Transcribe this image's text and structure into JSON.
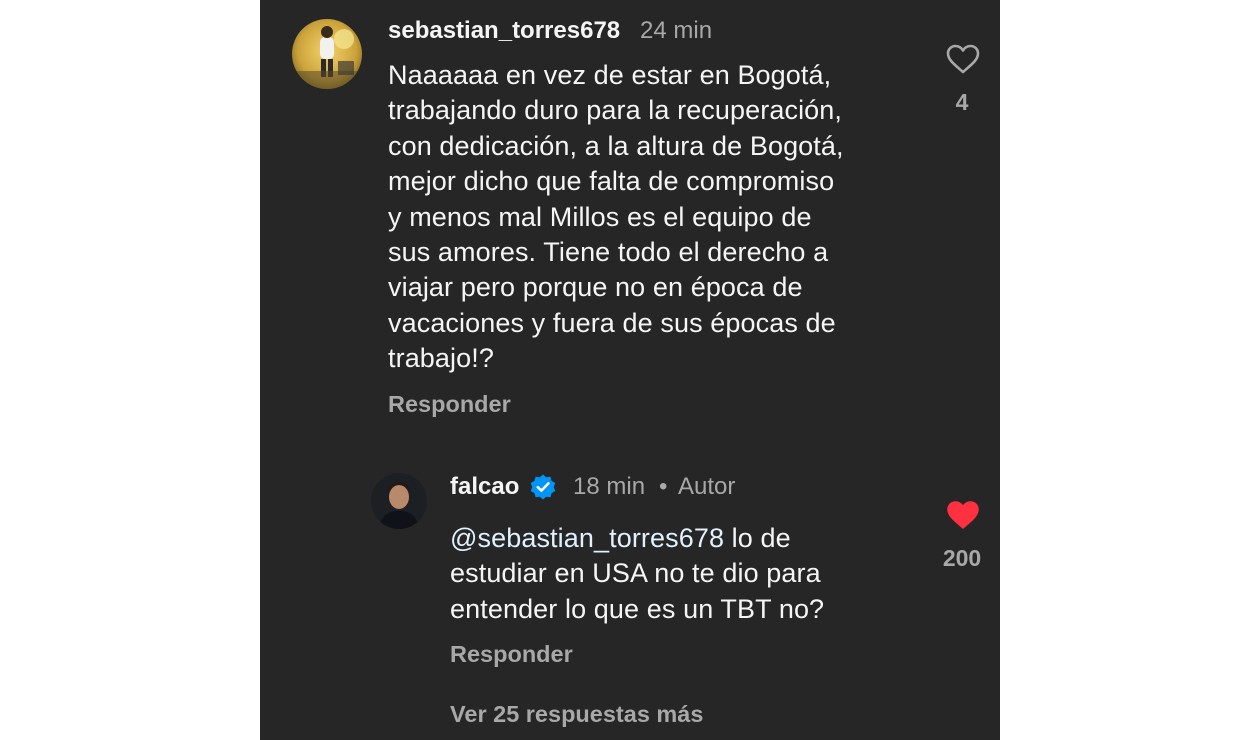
{
  "colors": {
    "background": "#262626",
    "text_primary": "#f5f5f5",
    "text_secondary": "#a8a8a8",
    "like_active": "#ff3040",
    "verified_badge": "#0095f6"
  },
  "comments": [
    {
      "username": "sebastian_torres678",
      "time": "24 min",
      "text": "Naaaaaa en vez de estar en Bogotá,\ntrabajando duro para la recuperación,\ncon dedicación, a la altura de Bogotá,\nmejor dicho que falta de compromiso\ny menos mal Millos es el equipo de\nsus amores. Tiene todo el derecho a\nviajar pero porque no en época de\nvacaciones y fuera de sus épocas de\ntrabajo!?",
      "reply_label": "Responder",
      "likes": "4",
      "liked": false,
      "like_icon": "heart-outline-icon"
    },
    {
      "username": "falcao",
      "verified": true,
      "verified_icon": "verified-badge-icon",
      "time": "18 min",
      "separator": "•",
      "author_label": "Autor",
      "mention": "@sebastian_torres678",
      "text": " lo de\nestudiar en USA no te dio para\nentender lo que es un TBT no?",
      "reply_label": "Responder",
      "likes": "200",
      "liked": true,
      "like_icon": "heart-filled-icon"
    }
  ],
  "more_replies_label": "Ver 25 respuestas más"
}
